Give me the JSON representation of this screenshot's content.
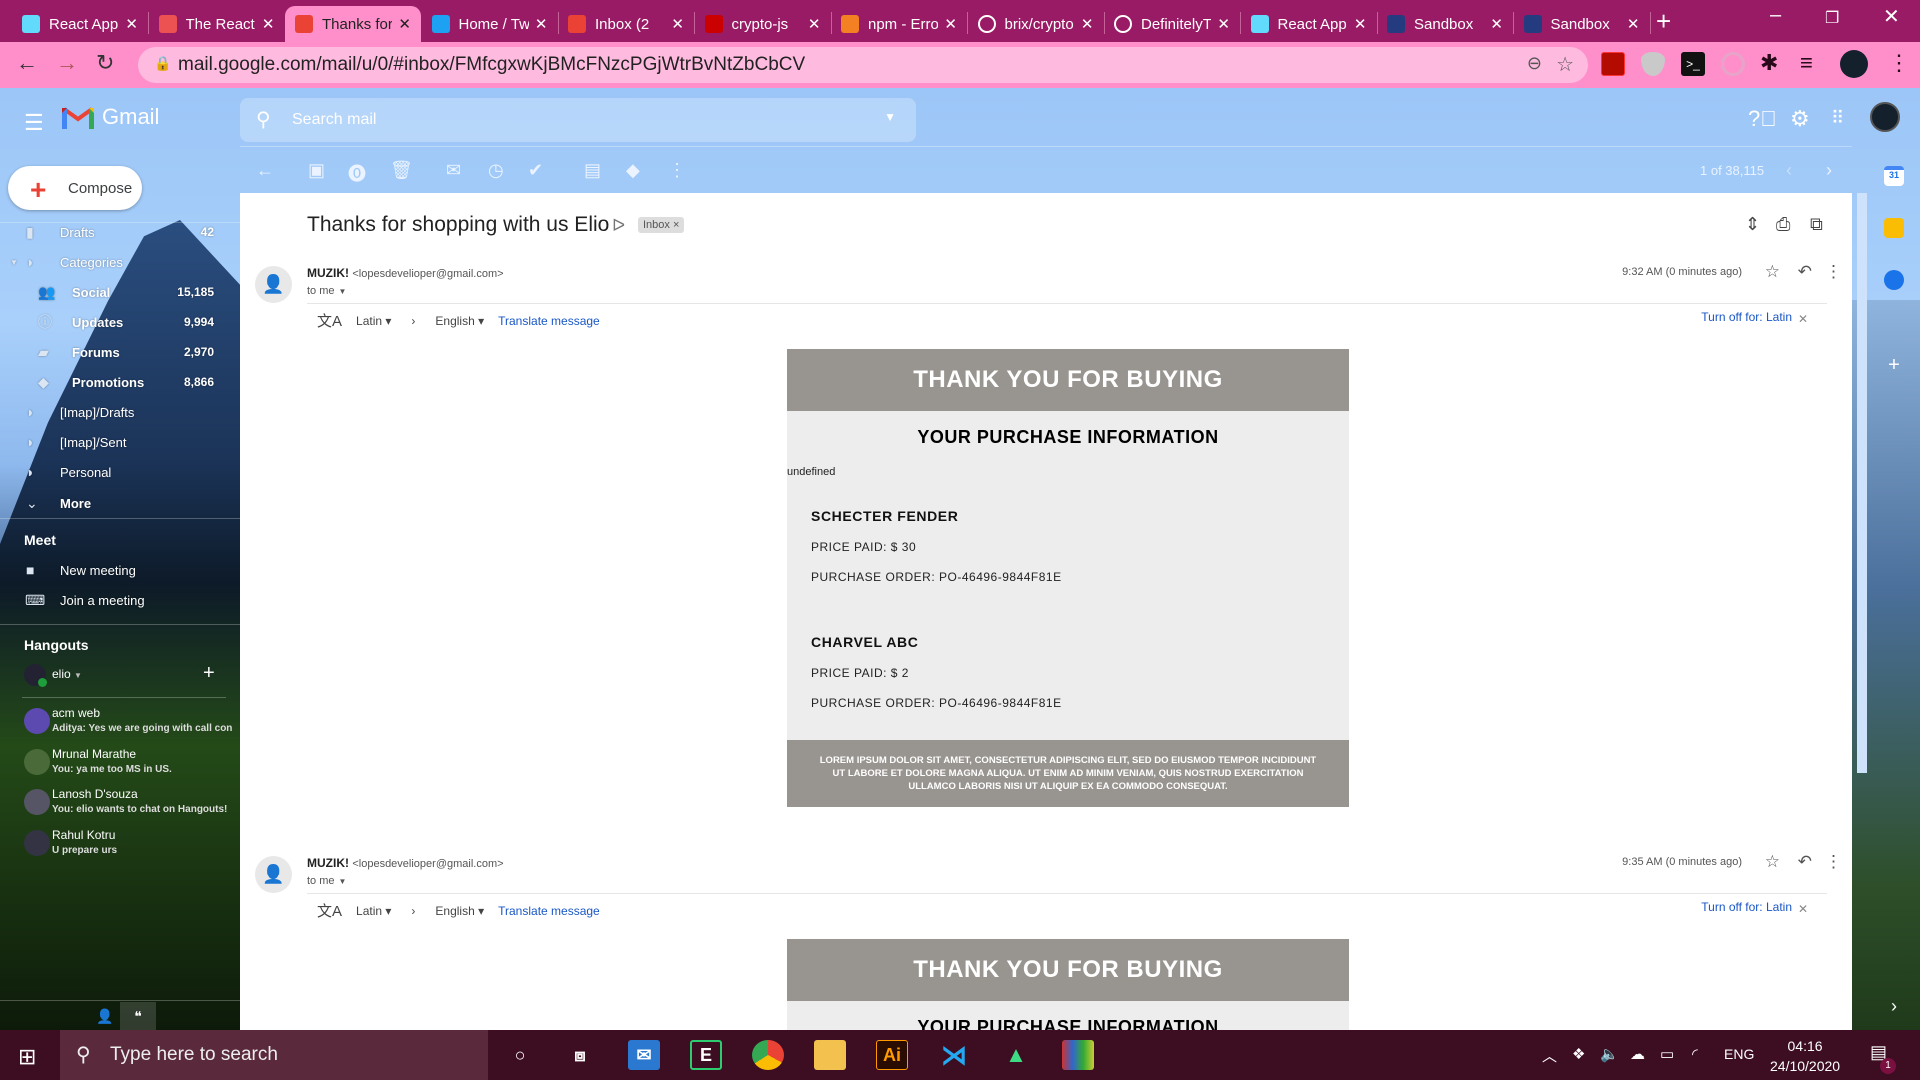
{
  "browser": {
    "tabs": [
      {
        "title": "React App",
        "icon": "react-icon",
        "color": "#61dafb"
      },
      {
        "title": "The React",
        "icon": "udemy-icon",
        "color": "#ec5252"
      },
      {
        "title": "Thanks for shopping",
        "icon": "gmail-icon",
        "color": "#ea4335",
        "active": true
      },
      {
        "title": "Home / Twitter",
        "icon": "twitter-icon",
        "color": "#1da1f2"
      },
      {
        "title": "Inbox (2",
        "icon": "gmail-icon",
        "color": "#ea4335"
      },
      {
        "title": "crypto-js",
        "icon": "npm-icon",
        "color": "#cb0000"
      },
      {
        "title": "npm - Error",
        "icon": "stackoverflow-icon",
        "color": "#f48024"
      },
      {
        "title": "brix/crypto",
        "icon": "github-icon",
        "color": "#ffffff"
      },
      {
        "title": "DefinitelyTyped",
        "icon": "github-icon",
        "color": "#ffffff"
      },
      {
        "title": "React App",
        "icon": "react-icon",
        "color": "#61dafb"
      },
      {
        "title": "Sandbox",
        "icon": "paypal-icon",
        "color": "#253b80"
      },
      {
        "title": "Sandbox",
        "icon": "paypal-icon",
        "color": "#253b80"
      }
    ],
    "new_tab": "+",
    "url": "mail.google.com/mail/u/0/#inbox/FMfcgxwKjBMcFNzcPGjWtrBvNtZbCbCV"
  },
  "gmail": {
    "brand": "Gmail",
    "search_placeholder": "Search mail",
    "pager": "1 of 38,115",
    "compose": "Compose",
    "sidebar": {
      "items": [
        {
          "label": "Drafts",
          "count": "42",
          "icon": "draft-icon"
        },
        {
          "label": "Categories",
          "count": "",
          "icon": "label-icon"
        },
        {
          "label": "Social",
          "count": "15,185",
          "icon": "people-icon"
        },
        {
          "label": "Updates",
          "count": "9,994",
          "icon": "info-icon"
        },
        {
          "label": "Forums",
          "count": "2,970",
          "icon": "forum-icon"
        },
        {
          "label": "Promotions",
          "count": "8,866",
          "icon": "tag-icon"
        },
        {
          "label": "[Imap]/Drafts",
          "count": "",
          "icon": "label-icon"
        },
        {
          "label": "[Imap]/Sent",
          "count": "",
          "icon": "label-icon"
        },
        {
          "label": "Personal",
          "count": "",
          "icon": "label-icon"
        },
        {
          "label": "More",
          "count": "",
          "icon": "chevron-down-icon"
        }
      ],
      "meet_title": "Meet",
      "meet_items": [
        "New meeting",
        "Join a meeting"
      ],
      "hangouts_title": "Hangouts",
      "hangouts_user": "elio",
      "chats": [
        {
          "name": "acm web",
          "message": "Aditya: Yes we are going with call con"
        },
        {
          "name": "Mrunal Marathe",
          "message": "You: ya me too MS in US."
        },
        {
          "name": "Lanosh D'souza",
          "message": "You: elio wants to chat on Hangouts!"
        },
        {
          "name": "Rahul Kotru",
          "message": "U prepare urs"
        }
      ]
    },
    "thread": {
      "subject": "Thanks for shopping with us Elio",
      "label_chip": "Inbox",
      "messages": [
        {
          "sender": "MUZIK!",
          "email": "<lopesdevelioper@gmail.com>",
          "to": "to me",
          "time": "9:32 AM (0 minutes ago)"
        },
        {
          "sender": "MUZIK!",
          "email": "<lopesdevelioper@gmail.com>",
          "to": "to me",
          "time": "9:35 AM (0 minutes ago)"
        }
      ],
      "translate": {
        "from": "Latin",
        "to": "English",
        "action": "Translate message",
        "turn_off": "Turn off for: Latin"
      }
    },
    "email_body": {
      "header": "THANK YOU FOR BUYING",
      "subheader": "YOUR PURCHASE INFORMATION",
      "undefined_text": "undefined",
      "items": [
        {
          "name": "SCHECTER FENDER",
          "price": "PRICE PAID: $ 30",
          "order": "PURCHASE ORDER: PO-46496-9844F81E"
        },
        {
          "name": "CHARVEL ABC",
          "price": "PRICE PAID: $ 2",
          "order": "PURCHASE ORDER: PO-46496-9844F81E"
        }
      ],
      "footer": "LOREM IPSUM DOLOR SIT AMET, CONSECTETUR ADIPISCING ELIT, SED DO EIUSMOD TEMPOR INCIDIDUNT UT LABORE ET DOLORE MAGNA ALIQUA. UT ENIM AD MINIM VENIAM, QUIS NOSTRUD EXERCITATION ULLAMCO LABORIS NISI UT ALIQUIP EX EA COMMODO CONSEQUAT."
    },
    "side_apps": {
      "calendar_day": "31"
    }
  },
  "taskbar": {
    "search_placeholder": "Type here to search",
    "language": "ENG",
    "time": "04:16",
    "date": "24/10/2020",
    "notifications": "1"
  }
}
